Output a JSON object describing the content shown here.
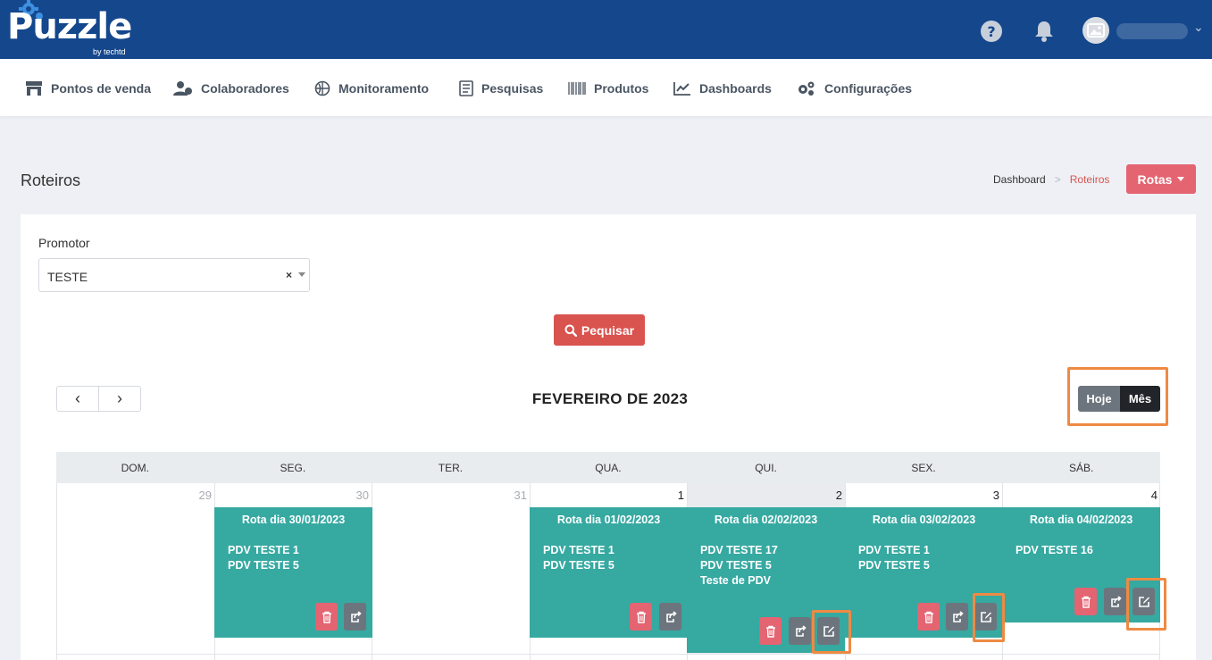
{
  "brand": {
    "name": "Puzzle",
    "sub": "by techtd"
  },
  "nav": [
    {
      "label": "Pontos de venda",
      "icon": "store-icon"
    },
    {
      "label": "Colaboradores",
      "icon": "users-icon"
    },
    {
      "label": "Monitoramento",
      "icon": "globe-icon"
    },
    {
      "label": "Pesquisas",
      "icon": "survey-icon"
    },
    {
      "label": "Produtos",
      "icon": "barcode-icon"
    },
    {
      "label": "Dashboards",
      "icon": "chart-line-icon"
    },
    {
      "label": "Configurações",
      "icon": "gears-icon"
    }
  ],
  "page": {
    "title": "Roteiros",
    "breadcrumb": {
      "home": "Dashboard",
      "separator": ">",
      "current": "Roteiros"
    },
    "rotas_label": "Rotas"
  },
  "filter": {
    "promotor_label": "Promotor",
    "promotor_value": "TESTE",
    "clear_symbol": "×",
    "search_label": "Pequisar"
  },
  "calendar": {
    "prev_symbol": "‹",
    "next_symbol": "›",
    "title": "FEVEREIRO DE 2023",
    "view_today": "Hoje",
    "view_month": "Mês",
    "weekdays": [
      "DOM.",
      "SEG.",
      "TER.",
      "QUA.",
      "QUI.",
      "SEX.",
      "SÁB."
    ],
    "days": [
      "29",
      "30",
      "31",
      "1",
      "2",
      "3",
      "4"
    ],
    "events": [
      {
        "title": "Rota dia 30/01/2023",
        "lines": [
          "PDV TESTE 1",
          "PDV TESTE 5"
        ]
      },
      {
        "title": "Rota dia 01/02/2023",
        "lines": [
          "PDV TESTE 1",
          "PDV TESTE 5"
        ]
      },
      {
        "title": "Rota dia 02/02/2023",
        "lines": [
          "PDV TESTE 17",
          "PDV TESTE 5",
          "Teste de PDV"
        ]
      },
      {
        "title": "Rota dia 03/02/2023",
        "lines": [
          "PDV TESTE 1",
          "PDV TESTE 5"
        ]
      },
      {
        "title": "Rota dia 04/02/2023",
        "lines": [
          "PDV TESTE 16"
        ]
      }
    ]
  },
  "colors": {
    "topbar": "#14478c",
    "accent_red": "#d9534f",
    "event_teal": "#36a9a1",
    "highlight_orange": "#ef8a43"
  }
}
